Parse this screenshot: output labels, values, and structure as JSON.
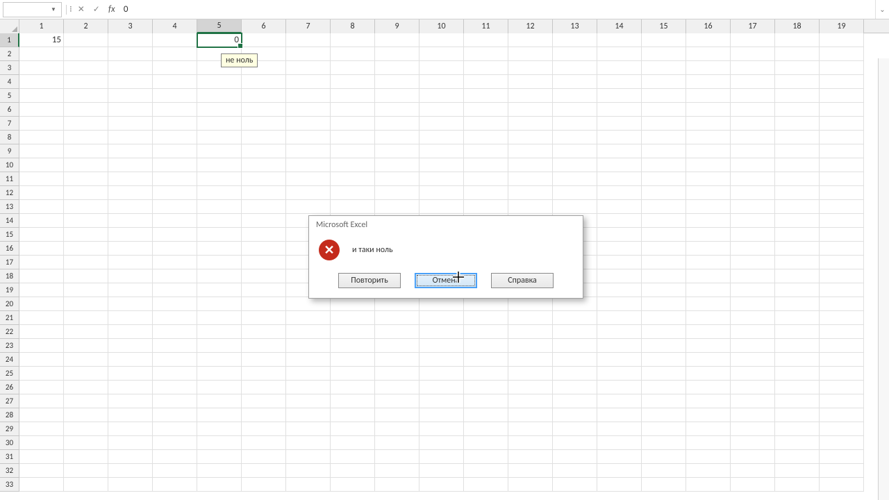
{
  "formulaBar": {
    "nameBox": "",
    "cancelGlyph": "✕",
    "acceptGlyph": "✓",
    "fxLabel": "fx",
    "value": "0"
  },
  "columns": [
    "1",
    "2",
    "3",
    "4",
    "5",
    "6",
    "7",
    "8",
    "9",
    "10",
    "11",
    "12",
    "13",
    "14",
    "15",
    "16",
    "17",
    "18",
    "19"
  ],
  "activeColIndex": 4,
  "rowCount": 33,
  "activeRowIndex": 0,
  "cells": {
    "r0c0": "15",
    "r0c4": "0"
  },
  "tooltip": "не ноль",
  "dialog": {
    "title": "Microsoft Excel",
    "message": "и таки ноль",
    "buttons": {
      "retry": "Повторить",
      "cancel": "Отмена",
      "help": "Справка"
    }
  }
}
